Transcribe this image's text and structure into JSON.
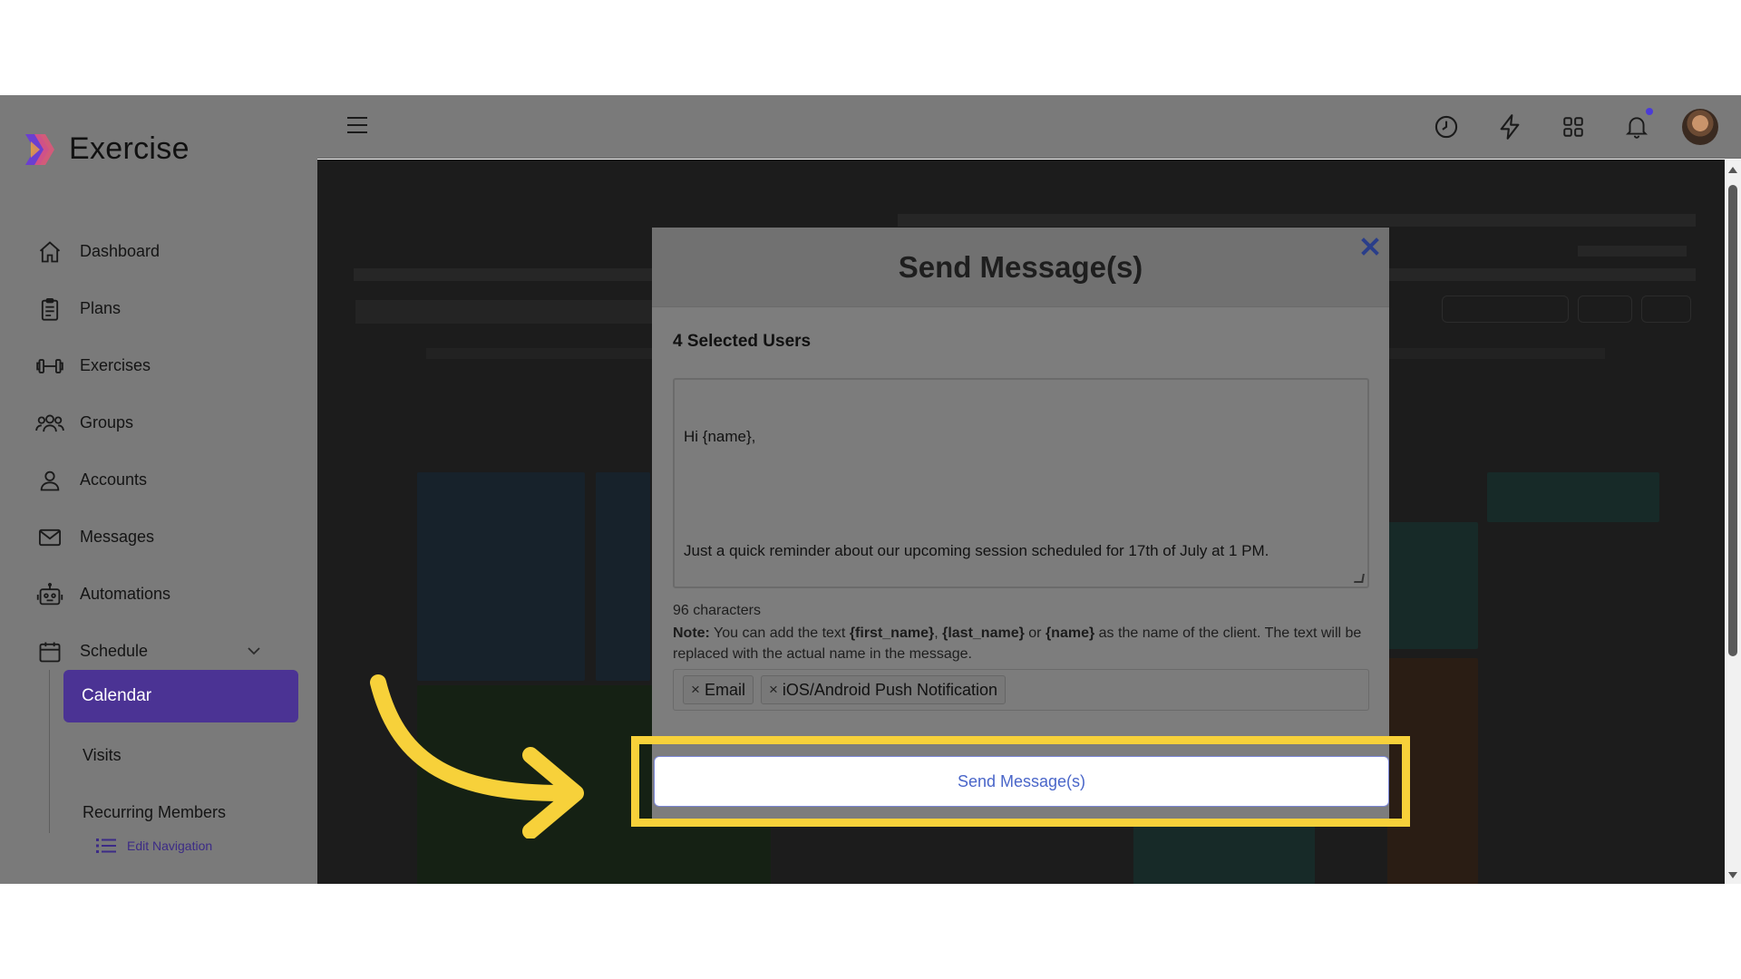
{
  "app": {
    "name": "Exercise"
  },
  "sidebar": {
    "items": [
      {
        "label": "Dashboard",
        "icon": "home-icon"
      },
      {
        "label": "Plans",
        "icon": "clipboard-icon"
      },
      {
        "label": "Exercises",
        "icon": "dumbbell-icon"
      },
      {
        "label": "Groups",
        "icon": "users-icon"
      },
      {
        "label": "Accounts",
        "icon": "user-icon"
      },
      {
        "label": "Messages",
        "icon": "mail-icon"
      },
      {
        "label": "Automations",
        "icon": "robot-icon"
      },
      {
        "label": "Schedule",
        "icon": "calendar-icon"
      }
    ],
    "schedule_sub": [
      {
        "label": "Calendar",
        "active": true
      },
      {
        "label": "Visits"
      },
      {
        "label": "Recurring Members"
      }
    ],
    "edit_navigation": "Edit Navigation"
  },
  "modal": {
    "title": "Send Message(s)",
    "selected_users": "4 Selected Users",
    "message_line1": "Hi {name},",
    "message_line2": "Just a quick reminder about our upcoming session scheduled for 17th of July at 1 PM.",
    "char_count": "96 characters",
    "note_label": "Note:",
    "note_text_1": "You can add the text",
    "note_var_first": "{first_name}",
    "note_comma": ",",
    "note_var_last": "{last_name}",
    "note_or": "or",
    "note_var_name": "{name}",
    "note_text_2": "as the name of the client. The text will be replaced with the actual name in the message.",
    "channels": [
      "Email",
      "iOS/Android Push Notification"
    ],
    "chip_remove": "×",
    "send_button": "Send Message(s)"
  },
  "colors": {
    "accent": "#4b3394",
    "highlight": "#f7d13a",
    "send_text": "#4a66c9"
  }
}
